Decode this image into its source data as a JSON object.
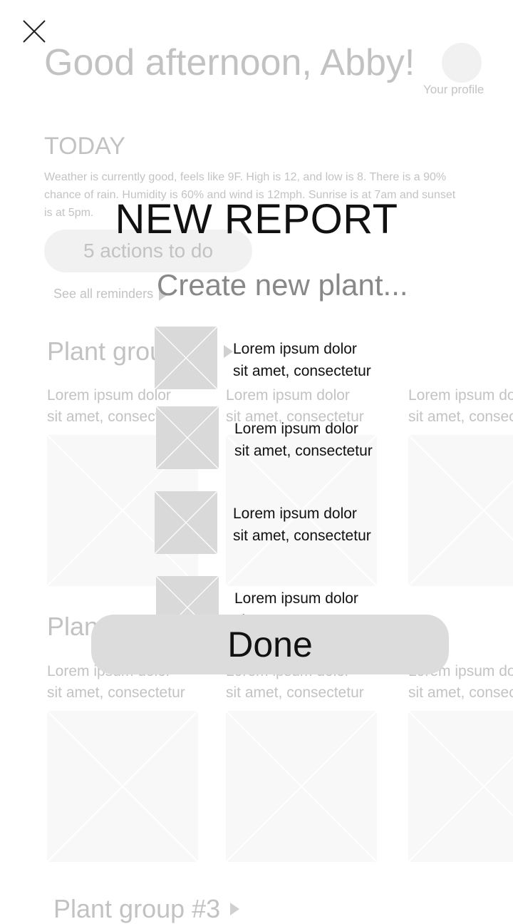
{
  "background": {
    "greeting": "Good afternoon, Abby!",
    "profile_label": "Your profile",
    "today_heading": "TODAY",
    "weather_text": "Weather is currently good, feels like 9F. High is 12, and low is 8. There is a 90% chance of rain. Humidity is 60% and wind is 12mph. Sunrise is at 7am and sunset is at 5pm.",
    "actions_label": "5 actions to do",
    "see_all_label": "See all reminders",
    "groups": [
      {
        "title": "Plant group #1",
        "cards": [
          {
            "line1": "Lorem ipsum dolor",
            "line2": "sit amet, consectetur"
          },
          {
            "line1": "Lorem ipsum dolor",
            "line2": "sit amet, consectetur"
          },
          {
            "line1": "Lorem ipsum dolor",
            "line2": "sit amet, consectetur"
          }
        ]
      },
      {
        "title": "Plant group #2",
        "cards": [
          {
            "line1": "Lorem ipsum dolor",
            "line2": "sit amet, consectetur"
          },
          {
            "line1": "Lorem ipsum dolor",
            "line2": "sit amet, consectetur"
          },
          {
            "line1": "Lorem ipsum dolor",
            "line2": "sit amet, consectetur"
          }
        ]
      },
      {
        "title": "Plant group #3"
      }
    ]
  },
  "modal": {
    "title": "NEW REPORT",
    "create_label": "Create new plant...",
    "items": [
      {
        "line1": "Lorem ipsum dolor",
        "line2": "sit amet, consectetur"
      },
      {
        "line1": "Lorem ipsum dolor",
        "line2": "sit amet, consectetur"
      },
      {
        "line1": "Lorem ipsum dolor",
        "line2": "sit amet, consectetur"
      },
      {
        "line1": "Lorem ipsum dolor",
        "line2": "sit amet, consectetur"
      }
    ],
    "done_label": "Done"
  },
  "icons": {
    "close": "close-icon",
    "placeholder": "image-placeholder-icon",
    "arrow": "play-arrow-icon"
  }
}
